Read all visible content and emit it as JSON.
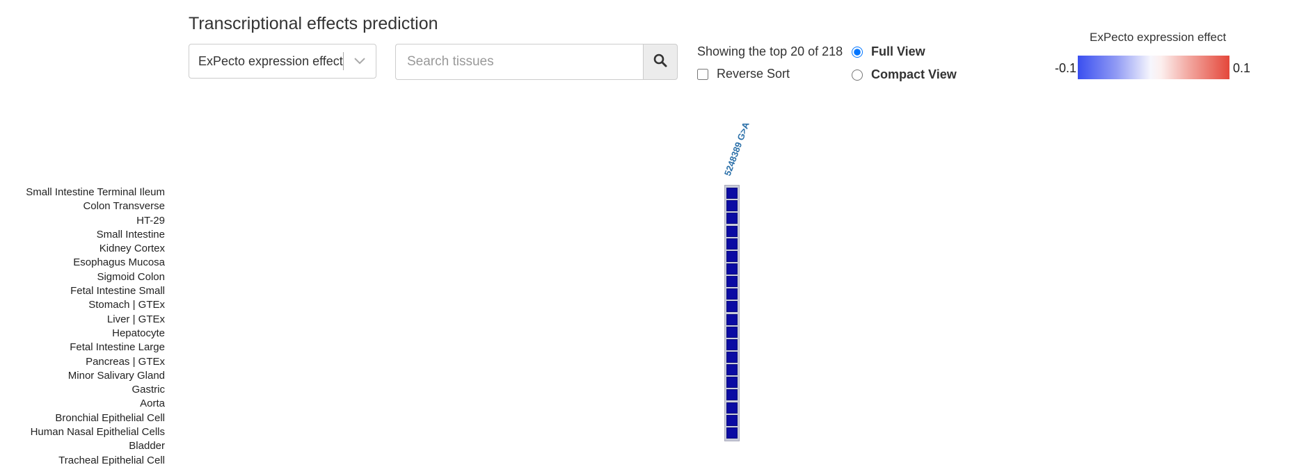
{
  "header": {
    "title": "Transcriptional effects prediction"
  },
  "controls": {
    "metric_select_value": "ExPecto expression effect",
    "search_placeholder": "Search tissues",
    "showing_text": "Showing the top 20 of 218",
    "reverse_sort_label": "Reverse Sort",
    "reverse_sort_checked": false,
    "view_options": [
      {
        "label": "Full View",
        "selected": true
      },
      {
        "label": "Compact View",
        "selected": false
      }
    ]
  },
  "legend": {
    "title": "ExPecto expression effect",
    "min_label": "-0.1",
    "max_label": "0.1",
    "colors": {
      "negative": "#3a4ff0",
      "neutral": "#f6f6fd",
      "positive": "#e4473a"
    }
  },
  "heatmap": {
    "column_label": "5248389 G>A",
    "cell_color": "#0b0ba3",
    "rows": [
      "Small Intestine Terminal Ileum",
      "Colon Transverse",
      "HT-29",
      "Small Intestine",
      "Kidney Cortex",
      "Esophagus Mucosa",
      "Sigmoid Colon",
      "Fetal Intestine Small",
      "Stomach | GTEx",
      "Liver | GTEx",
      "Hepatocyte",
      "Fetal Intestine Large",
      "Pancreas | GTEx",
      "Minor Salivary Gland",
      "Gastric",
      "Aorta",
      "Bronchial Epithelial Cell",
      "Human Nasal Epithelial Cells",
      "Bladder",
      "Tracheal Epithelial Cell"
    ]
  },
  "icons": {
    "select_arrow": "chevron-down-icon",
    "search_button": "search-icon"
  }
}
